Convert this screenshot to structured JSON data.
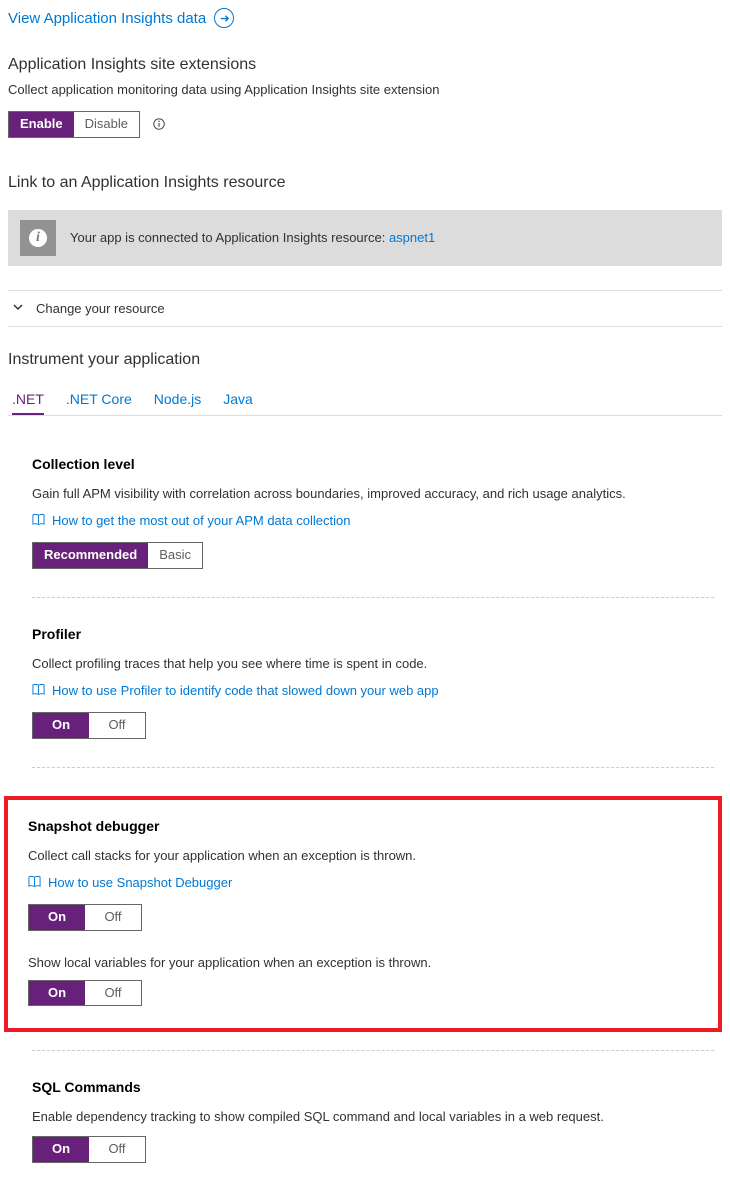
{
  "topLink": {
    "label": "View Application Insights data"
  },
  "siteExtensions": {
    "title": "Application Insights site extensions",
    "desc": "Collect application monitoring data using Application Insights site extension",
    "enable": "Enable",
    "disable": "Disable"
  },
  "linkResource": {
    "title": "Link to an Application Insights resource",
    "bannerText": "Your app is connected to Application Insights resource: ",
    "resourceName": "aspnet1",
    "changeResource": "Change your resource"
  },
  "instrument": {
    "title": "Instrument your application",
    "tabs": [
      ".NET",
      ".NET Core",
      "Node.js",
      "Java"
    ]
  },
  "collectionLevel": {
    "title": "Collection level",
    "desc": "Gain full APM visibility with correlation across boundaries, improved accuracy, and rich usage analytics.",
    "docLink": "How to get the most out of your APM data collection",
    "recommended": "Recommended",
    "basic": "Basic"
  },
  "profiler": {
    "title": "Profiler",
    "desc": "Collect profiling traces that help you see where time is spent in code.",
    "docLink": "How to use Profiler to identify code that slowed down your web app",
    "on": "On",
    "off": "Off"
  },
  "snapshot": {
    "title": "Snapshot debugger",
    "desc": "Collect call stacks for your application when an exception is thrown.",
    "docLink": "How to use Snapshot Debugger",
    "on": "On",
    "off": "Off",
    "subLabel": "Show local variables for your application when an exception is thrown."
  },
  "sql": {
    "title": "SQL Commands",
    "desc": "Enable dependency tracking to show compiled SQL command and local variables in a web request.",
    "on": "On",
    "off": "Off"
  }
}
